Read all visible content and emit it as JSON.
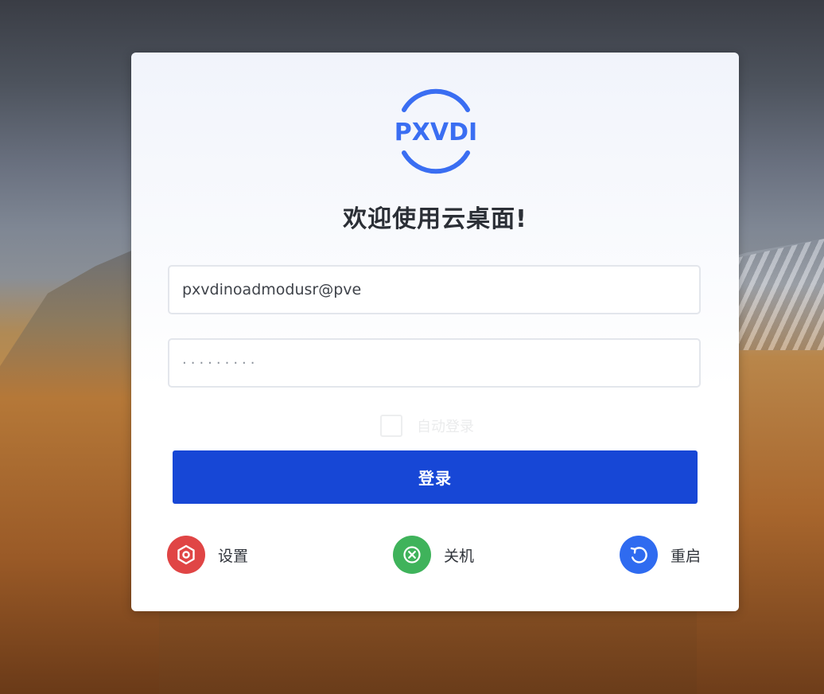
{
  "login": {
    "logo_text": "PXVDI",
    "welcome": "欢迎使用云桌面!",
    "username_value": "pxvdinoadmodusr@pve",
    "password_mask": "·········",
    "remember_label": "自动登录",
    "login_button": "登录"
  },
  "actions": {
    "settings": {
      "label": "设置",
      "icon": "settings-icon",
      "color": "#e04545"
    },
    "shutdown": {
      "label": "关机",
      "icon": "power-off-icon",
      "color": "#3fb35b"
    },
    "restart": {
      "label": "重启",
      "icon": "restart-icon",
      "color": "#2f6bf0"
    }
  },
  "colors": {
    "brand": "#3a6ef2",
    "login_button": "#1747d6"
  }
}
